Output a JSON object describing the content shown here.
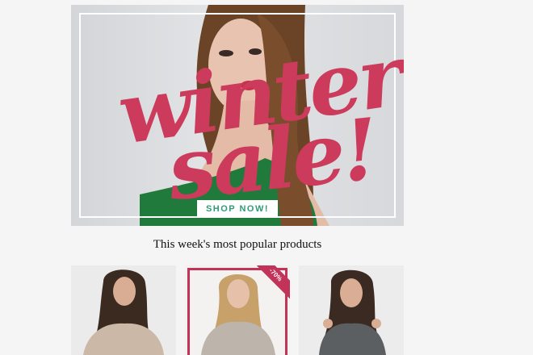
{
  "banner": {
    "headline_line1": "winter",
    "headline_line2": "sale!",
    "cta_label": "SHOP NOW!",
    "accent_color": "#cc3a5c",
    "cta_text_color": "#2f9a78"
  },
  "section": {
    "title": "This week's most popular products"
  },
  "products": [
    {
      "badge": ""
    },
    {
      "badge": "-70%"
    },
    {
      "badge": ""
    }
  ],
  "colors": {
    "sale_badge": "#c2335a",
    "background": "#f5f5f5"
  }
}
